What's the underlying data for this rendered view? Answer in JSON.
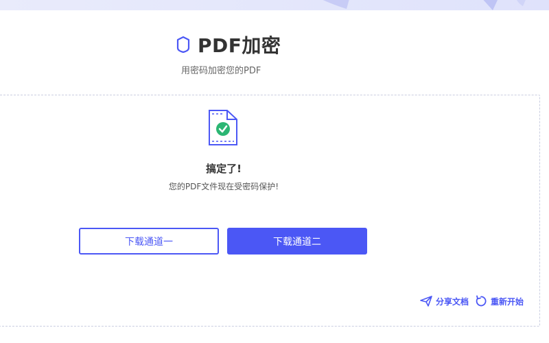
{
  "header": {
    "title": "PDF加密",
    "subtitle": "用密码加密您的PDF",
    "icon": "shield-icon"
  },
  "result": {
    "title": "搞定了!",
    "message": "您的PDF文件现在受密码保护!",
    "icon": "locked-file-check-icon"
  },
  "buttons": {
    "download_one": "下载通道一",
    "download_two": "下载通道二"
  },
  "actions": {
    "share_label": "分享文档",
    "share_icon": "paper-plane-icon",
    "restart_label": "重新开始",
    "restart_icon": "refresh-icon"
  },
  "colors": {
    "accent": "#4b57f5",
    "success": "#2bb673"
  }
}
